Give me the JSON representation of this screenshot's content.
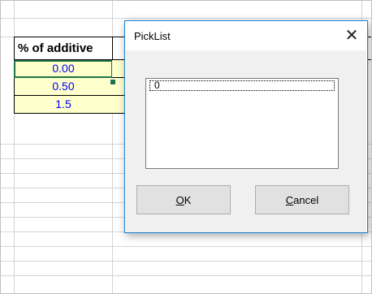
{
  "sheet": {
    "column_header": "% of additive",
    "values": [
      "0.00",
      "0.50",
      "1.5"
    ]
  },
  "dialog": {
    "title": "PickList",
    "close_glyph": "✕",
    "list_items": [
      "0"
    ],
    "ok": {
      "mnemonic": "O",
      "rest": "K"
    },
    "cancel": {
      "mnemonic": "C",
      "rest": "ancel"
    }
  }
}
